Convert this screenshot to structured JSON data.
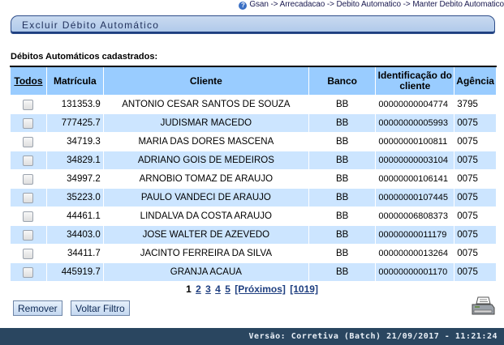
{
  "breadcrumb": "Gsan -> Arrecadacao -> Debito Automatico -> Manter Debito Automatico",
  "window_title": "Excluir Débito Automático",
  "section_title": "Débitos Automáticos cadastrados:",
  "table": {
    "headers": {
      "todos": "Todos",
      "matricula": "Matrícula",
      "cliente": "Cliente",
      "banco": "Banco",
      "identificacao_line1": "Identificação do",
      "identificacao_line2": "cliente",
      "agencia": "Agência"
    },
    "rows": [
      {
        "matricula": "131353.9",
        "cliente": "ANTONIO CESAR SANTOS DE SOUZA",
        "banco": "BB",
        "identificacao": "00000000004774",
        "agencia": "3795"
      },
      {
        "matricula": "777425.7",
        "cliente": "JUDISMAR MACEDO",
        "banco": "BB",
        "identificacao": "00000000005993",
        "agencia": "0075"
      },
      {
        "matricula": "34719.3",
        "cliente": "MARIA DAS DORES MASCENA",
        "banco": "BB",
        "identificacao": "00000000100811",
        "agencia": "0075"
      },
      {
        "matricula": "34829.1",
        "cliente": "ADRIANO GOIS DE MEDEIROS",
        "banco": "BB",
        "identificacao": "00000000003104",
        "agencia": "0075"
      },
      {
        "matricula": "34997.2",
        "cliente": "ARNOBIO TOMAZ DE ARAUJO",
        "banco": "BB",
        "identificacao": "00000000106141",
        "agencia": "0075"
      },
      {
        "matricula": "35223.0",
        "cliente": "PAULO VANDECI DE ARAUJO",
        "banco": "BB",
        "identificacao": "00000000107445",
        "agencia": "0075"
      },
      {
        "matricula": "44461.1",
        "cliente": "LINDALVA DA COSTA ARAUJO",
        "banco": "BB",
        "identificacao": "00000006808373",
        "agencia": "0075"
      },
      {
        "matricula": "34403.0",
        "cliente": "JOSE WALTER DE AZEVEDO",
        "banco": "BB",
        "identificacao": "00000000011179",
        "agencia": "0075"
      },
      {
        "matricula": "34411.7",
        "cliente": "JACINTO FERREIRA DA SILVA",
        "banco": "BB",
        "identificacao": "00000000013264",
        "agencia": "0075"
      },
      {
        "matricula": "445919.7",
        "cliente": "GRANJA ACAUA",
        "banco": "BB",
        "identificacao": "00000000001170",
        "agencia": "0075"
      }
    ]
  },
  "pager": {
    "current": "1",
    "pages": [
      "2",
      "3",
      "4",
      "5"
    ],
    "next": "[Próximos]",
    "last": "[1019]"
  },
  "buttons": {
    "remover": "Remover",
    "voltar_filtro": "Voltar Filtro"
  },
  "footer": "Versão: Corretiva (Batch) 21/09/2017 - 11:21:24",
  "icons": {
    "help": "help-icon",
    "printer": "printer-icon"
  },
  "colors": {
    "header_bg": "#99ccff",
    "row_alt": "#cce5ff",
    "footer_bg": "#2a4660"
  }
}
